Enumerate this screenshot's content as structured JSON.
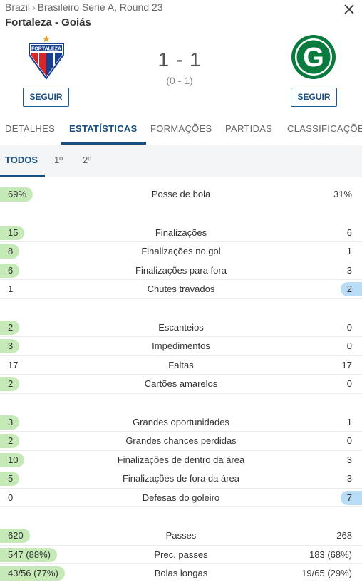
{
  "breadcrumb": {
    "country": "Brazil",
    "separator": "›",
    "competition": "Brasileiro Serie A, Round 23"
  },
  "match": {
    "title": "Fortaleza - Goiás",
    "score": "1 - 1",
    "halftime": "(0 - 1)",
    "home": {
      "crest_text": "FORTALEZA",
      "follow_label": "SEGUIR",
      "colors": [
        "#1a3f8f",
        "#d7262c",
        "#ffffff"
      ]
    },
    "away": {
      "crest_letter": "G",
      "follow_label": "SEGUIR",
      "colors": [
        "#0a7a3f",
        "#ffffff"
      ]
    }
  },
  "tabs": [
    {
      "label": "DETALHES",
      "active": false
    },
    {
      "label": "ESTATÍSTICAS",
      "active": true
    },
    {
      "label": "FORMAÇÕES",
      "active": false
    },
    {
      "label": "PARTIDAS",
      "active": false
    },
    {
      "label": "CLASSIFICAÇÕES",
      "active": false
    }
  ],
  "periods": [
    {
      "label": "TODOS",
      "active": true
    },
    {
      "label": "1º",
      "active": false
    },
    {
      "label": "2º",
      "active": false
    }
  ],
  "colors": {
    "accent": "#1a4f80",
    "home_highlight": "#c6e9b8",
    "away_highlight": "#b9dcf7"
  },
  "stats": [
    {
      "rows": [
        {
          "label": "Posse de bola",
          "home": "69%",
          "away": "31%",
          "leader": "home"
        }
      ]
    },
    {
      "rows": [
        {
          "label": "Finalizações",
          "home": "15",
          "away": "6",
          "leader": "home"
        },
        {
          "label": "Finalizações no gol",
          "home": "8",
          "away": "1",
          "leader": "home"
        },
        {
          "label": "Finalizações para fora",
          "home": "6",
          "away": "3",
          "leader": "home"
        },
        {
          "label": "Chutes travados",
          "home": "1",
          "away": "2",
          "leader": "away"
        }
      ]
    },
    {
      "rows": [
        {
          "label": "Escanteios",
          "home": "2",
          "away": "0",
          "leader": "home"
        },
        {
          "label": "Impedimentos",
          "home": "3",
          "away": "0",
          "leader": "home"
        },
        {
          "label": "Faltas",
          "home": "17",
          "away": "17",
          "leader": "none"
        },
        {
          "label": "Cartões amarelos",
          "home": "2",
          "away": "0",
          "leader": "home"
        }
      ]
    },
    {
      "rows": [
        {
          "label": "Grandes oportunidades",
          "home": "3",
          "away": "1",
          "leader": "home"
        },
        {
          "label": "Grandes chances perdidas",
          "home": "2",
          "away": "0",
          "leader": "home"
        },
        {
          "label": "Finalizações de dentro da área",
          "home": "10",
          "away": "3",
          "leader": "home"
        },
        {
          "label": "Finalizações de fora da área",
          "home": "5",
          "away": "3",
          "leader": "home"
        },
        {
          "label": "Defesas do goleiro",
          "home": "0",
          "away": "7",
          "leader": "away"
        }
      ]
    },
    {
      "rows": [
        {
          "label": "Passes",
          "home": "620",
          "away": "268",
          "leader": "home"
        },
        {
          "label": "Prec. passes",
          "home": "547 (88%)",
          "away": "183 (68%)",
          "leader": "home"
        },
        {
          "label": "Bolas longas",
          "home": "43/56 (77%)",
          "away": "19/65 (29%)",
          "leader": "home"
        }
      ]
    }
  ]
}
